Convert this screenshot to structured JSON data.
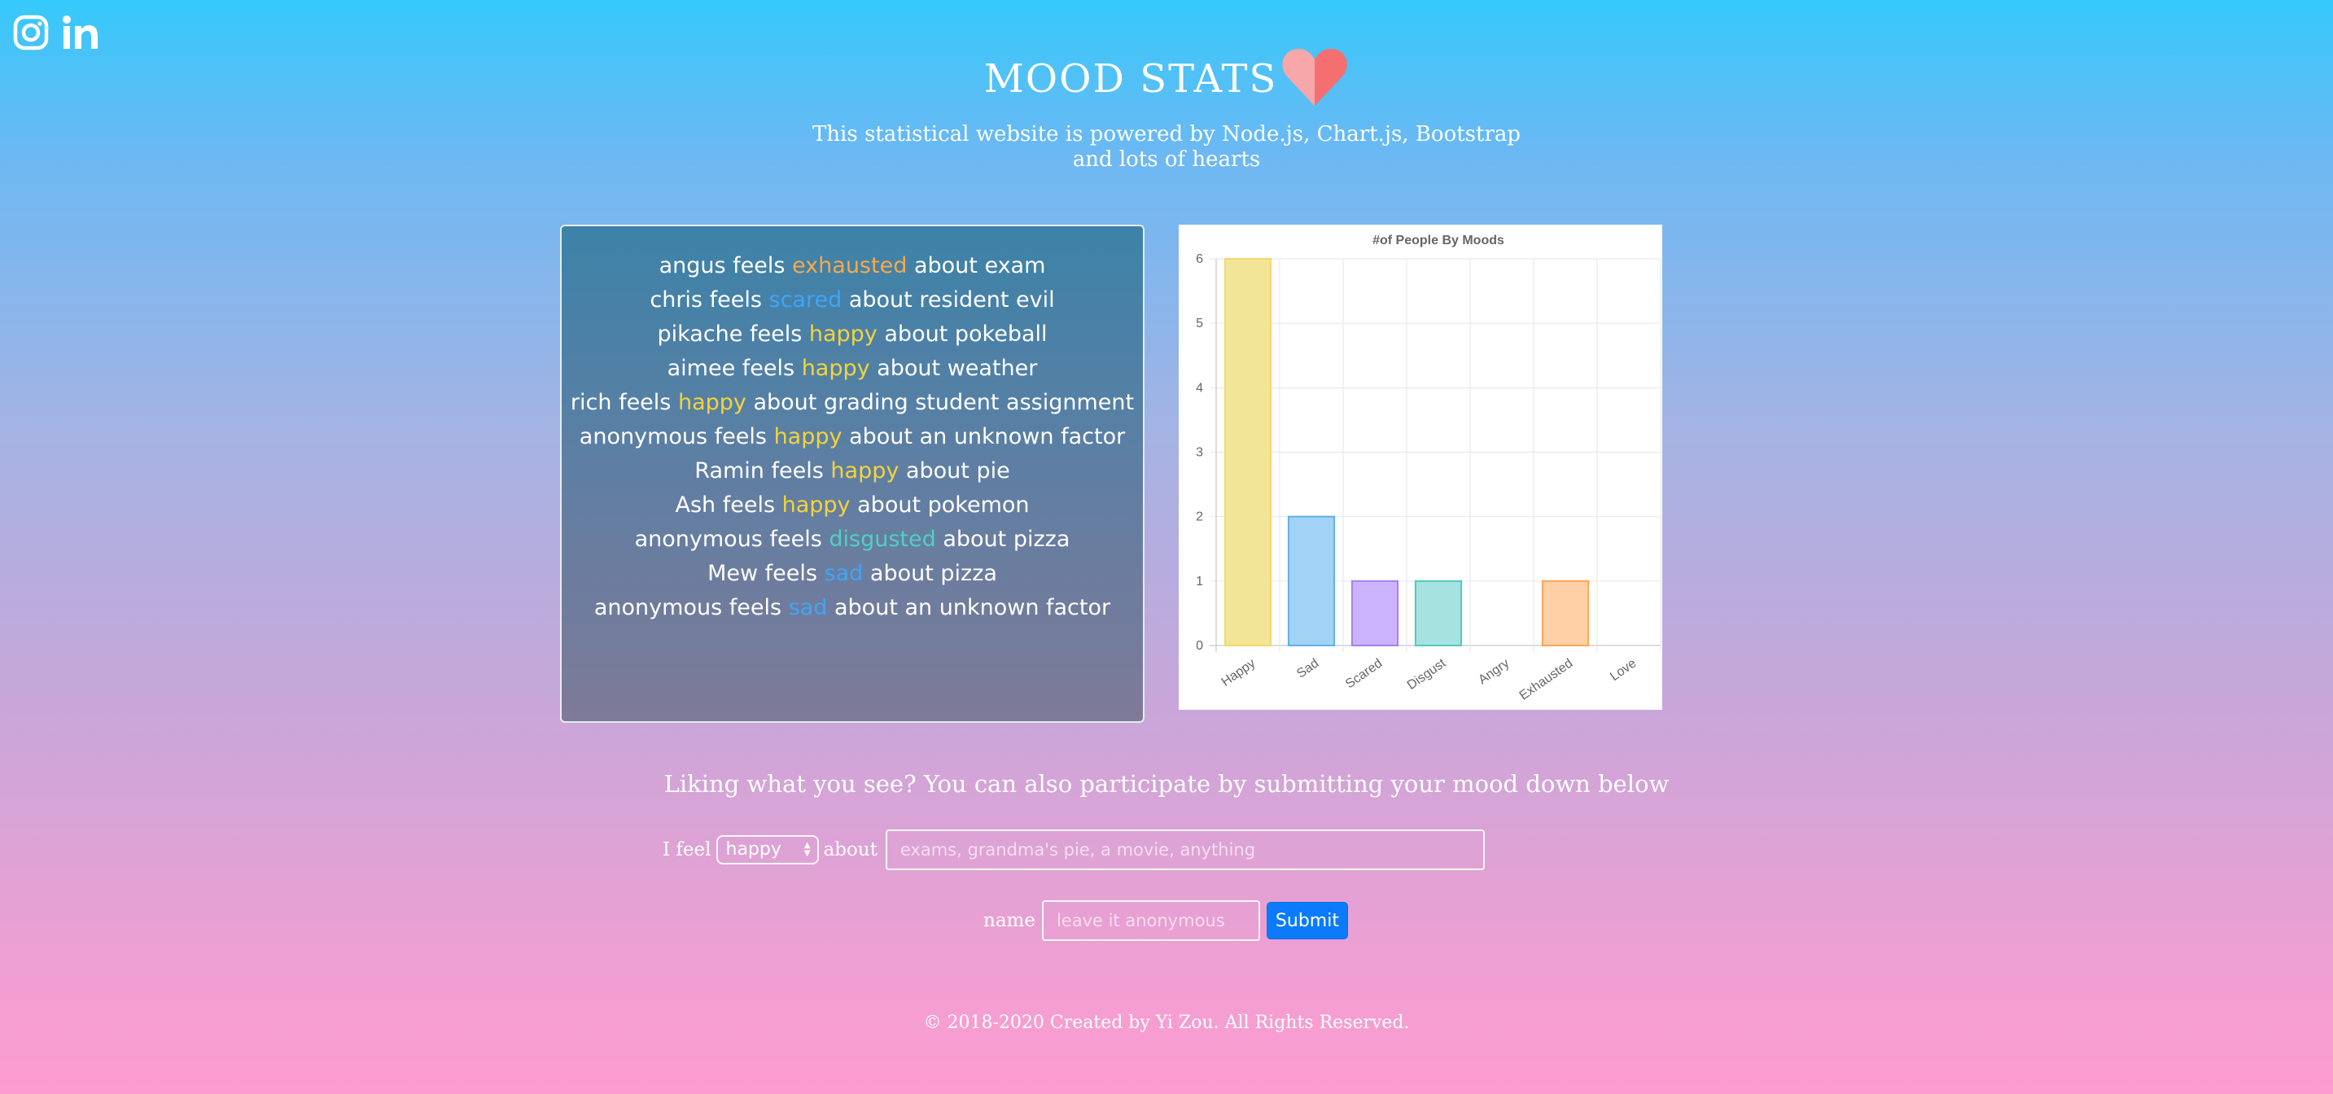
{
  "social": {
    "icons": [
      "instagram-icon",
      "linkedin-icon"
    ]
  },
  "header": {
    "title": "MOOD STATS",
    "subtitle_line1": "This statistical website is powered by Node.js, Chart.js, Bootstrap",
    "subtitle_line2": "and lots of hearts",
    "heart_colors": [
      "#f7a6a9",
      "#f56f71"
    ]
  },
  "feed": [
    {
      "name": "angus",
      "mood": "exhausted",
      "topic": "exam"
    },
    {
      "name": "chris",
      "mood": "scared",
      "topic": "resident evil"
    },
    {
      "name": "pikache",
      "mood": "happy",
      "topic": "pokeball"
    },
    {
      "name": "aimee",
      "mood": "happy",
      "topic": "weather"
    },
    {
      "name": "rich",
      "mood": "happy",
      "topic": "grading student assignment"
    },
    {
      "name": "anonymous",
      "mood": "happy",
      "topic": "an unknown factor"
    },
    {
      "name": "Ramin",
      "mood": "happy",
      "topic": "pie"
    },
    {
      "name": "Ash",
      "mood": "happy",
      "topic": "pokemon"
    },
    {
      "name": "anonymous",
      "mood": "disgusted",
      "topic": "pizza"
    },
    {
      "name": "Mew",
      "mood": "sad",
      "topic": "pizza"
    },
    {
      "name": "anonymous",
      "mood": "sad",
      "topic": "an unknown factor"
    }
  ],
  "feed_words": {
    "feels": "feels",
    "about": "about"
  },
  "chart_data": {
    "type": "bar",
    "title": "#of People By Moods",
    "categories": [
      "Happy",
      "Sad",
      "Scared",
      "Disgust",
      "Angry",
      "Exhausted",
      "Love"
    ],
    "values": [
      6,
      2,
      1,
      1,
      0,
      1,
      0
    ],
    "ylim": [
      0,
      6
    ],
    "yticks": [
      0,
      1,
      2,
      3,
      4,
      5,
      6
    ],
    "grid": true,
    "fill_colors": [
      "#f3e597",
      "#a2d3f6",
      "#ccb4fd",
      "#a6e2e0",
      "#ffc6ce",
      "#ffd0a5",
      "#ffc6ce"
    ],
    "stroke_colors": [
      "#f4d86c",
      "#5fb2ec",
      "#a57ff7",
      "#55c6c2",
      "#ff6384",
      "#ffa455",
      "#ff6384"
    ]
  },
  "participate": {
    "text": "Liking what you see? You can also participate by submitting your mood down below"
  },
  "form": {
    "i_feel_label": "I feel",
    "mood_value": "happy",
    "about_label": "about",
    "about_placeholder": "exams, grandma's pie, a movie, anything",
    "name_label": "name",
    "name_placeholder": "leave it anonymous",
    "submit_label": "Submit"
  },
  "footer": {
    "text": "© 2018-2020 Created by Yi Zou. All Rights Reserved."
  }
}
